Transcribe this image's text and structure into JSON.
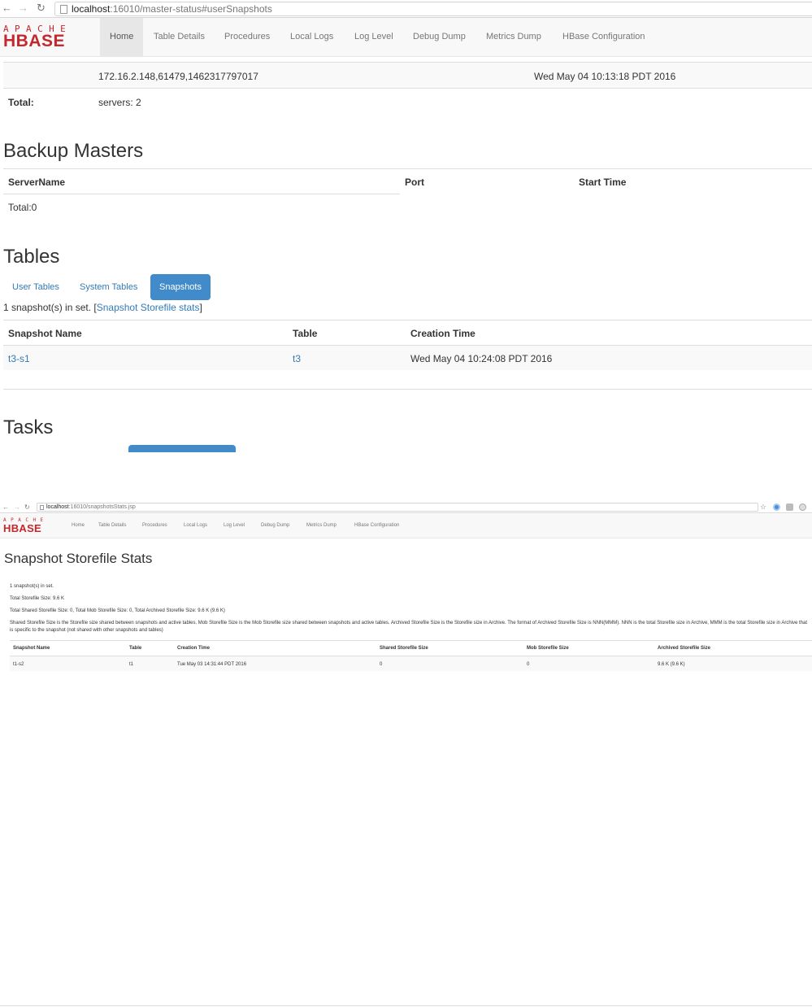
{
  "colors": {
    "brand": "#c4272c",
    "link": "#337ab7",
    "active_tab": "#428bca"
  },
  "master": {
    "browser": {
      "url_host": "localhost",
      "url_rest": ":16010/master-status#userSnapshots"
    },
    "nav": {
      "logo_top": "APACHE",
      "logo_main": "HBASE",
      "items": [
        "Home",
        "Table Details",
        "Procedures",
        "Local Logs",
        "Log Level",
        "Debug Dump",
        "Metrics Dump",
        "HBase Configuration"
      ]
    },
    "region_servers": {
      "row": {
        "server": "172.16.2.148,61479,1462317797017",
        "start_time": "Wed May 04 10:13:18 PDT 2016"
      },
      "total_label": "Total:",
      "total_value": "servers: 2"
    },
    "backup_masters": {
      "heading": "Backup Masters",
      "columns": [
        "ServerName",
        "Port",
        "Start Time"
      ],
      "total": "Total:0"
    },
    "tables": {
      "heading": "Tables",
      "tabs": [
        "User Tables",
        "System Tables",
        "Snapshots"
      ],
      "summary_prefix": "1 snapshot(s) in set. [",
      "summary_link": "Snapshot Storefile stats",
      "summary_suffix": "]",
      "columns": [
        "Snapshot Name",
        "Table",
        "Creation Time"
      ],
      "rows": [
        {
          "name": "t3-s1",
          "table": "t3",
          "created": "Wed May 04 10:24:08 PDT 2016"
        }
      ]
    },
    "tasks": {
      "heading": "Tasks"
    }
  },
  "stats": {
    "browser": {
      "url_host": "localhost",
      "url_rest": ":16010/snapshotsStats.jsp"
    },
    "nav": {
      "logo_top": "APACHE",
      "logo_main": "HBASE",
      "items": [
        "Home",
        "Table Details",
        "Procedures",
        "Local Logs",
        "Log Level",
        "Debug Dump",
        "Metrics Dump",
        "HBase Configuration"
      ]
    },
    "heading": "Snapshot Storefile Stats",
    "count_line": "1 snapshot(s) in set.",
    "total_line": "Total Storefile Size: 9.6 K",
    "breakdown_line": "Total Shared Storefile Size: 0, Total Mob Storefile Size: 0, Total Archived Storefile Size: 9.6 K (9.6 K)",
    "description": "Shared Storefile Size is the Storefile size shared between snapshots and active tables. Mob Storefile Size is the Mob Storefile size shared between snapshots and active tables. Archived Storefile Size is the Storefile size in Archive. The format of Archived Storefile Size is NNN(MMM). NNN is the total Storefile size in Archive, MMM is the total Storefile size in Archive that is specific to the snapshot (not shared with other snapshots and tables)",
    "columns": [
      "Snapshot Name",
      "Table",
      "Creation Time",
      "Shared Storefile Size",
      "Mob Storefile Size",
      "Archived Storefile Size"
    ],
    "rows": [
      {
        "name": "t1-s2",
        "table": "t1",
        "created": "Tue May 03 14:31:44 PDT 2016",
        "shared": "0",
        "mob": "0",
        "archived": "9.6 K (9.6 K)"
      }
    ]
  }
}
